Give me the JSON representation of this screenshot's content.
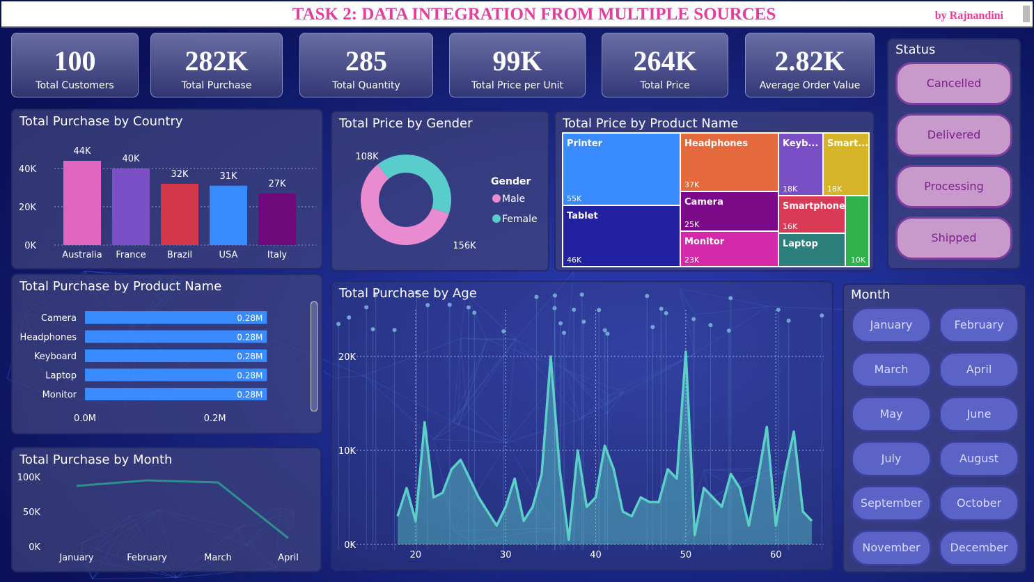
{
  "header": {
    "title": "TASK 2: DATA INTEGRATION FROM MULTIPLE SOURCES",
    "byline": "by Rajnandini"
  },
  "kpis": [
    {
      "value": "100",
      "label": "Total Customers"
    },
    {
      "value": "282K",
      "label": "Total Purchase"
    },
    {
      "value": "285",
      "label": "Total Quantity"
    },
    {
      "value": "99K",
      "label": "Total Price per Unit"
    },
    {
      "value": "264K",
      "label": "Total Price"
    },
    {
      "value": "2.82K",
      "label": "Average Order Value"
    }
  ],
  "status": {
    "title": "Status",
    "items": [
      "Cancelled",
      "Delivered",
      "Processing",
      "Shipped"
    ]
  },
  "month_slicer": {
    "title": "Month",
    "items": [
      "January",
      "February",
      "March",
      "April",
      "May",
      "June",
      "July",
      "August",
      "September",
      "October",
      "November",
      "December"
    ]
  },
  "colors": {
    "pink": "#e066c0",
    "purple": "#7b4fc6",
    "red": "#d13649",
    "blue": "#3a8bff",
    "darkpurple": "#6e0a7c",
    "teal": "#5ccfc8",
    "male": "#e98bd0",
    "female": "#59cccc"
  },
  "chart_data": [
    {
      "id": "country",
      "type": "bar",
      "title": "Total Purchase by Country",
      "categories": [
        "Australia",
        "France",
        "Brazil",
        "USA",
        "Italy"
      ],
      "values": [
        44,
        40,
        32,
        31,
        27
      ],
      "data_labels": [
        "44K",
        "40K",
        "32K",
        "31K",
        "27K"
      ],
      "yticks": [
        "0K",
        "20K",
        "40K"
      ],
      "ylim": [
        0,
        50
      ]
    },
    {
      "id": "gender",
      "type": "pie",
      "title": "Total Price by Gender",
      "legend_title": "Gender",
      "categories": [
        "Male",
        "Female"
      ],
      "values": [
        156,
        108
      ],
      "data_labels": [
        "156K",
        "108K"
      ]
    },
    {
      "id": "product_price",
      "type": "heatmap",
      "title": "Total Price by Product Name",
      "categories": [
        "Printer",
        "Tablet",
        "Headphones",
        "Camera",
        "Monitor",
        "Keyb...",
        "Smart...",
        "Smartphone",
        "Laptop",
        ""
      ],
      "values": [
        55,
        46,
        37,
        25,
        23,
        18,
        18,
        16,
        13,
        10
      ],
      "data_labels": [
        "55K",
        "46K",
        "37K",
        "25K",
        "23K",
        "18K",
        "18K",
        "16K",
        "",
        "10K"
      ]
    },
    {
      "id": "product_purchase",
      "type": "bar",
      "orientation": "horizontal",
      "title": "Total Purchase by Product Name",
      "categories": [
        "Camera",
        "Headphones",
        "Keyboard",
        "Laptop",
        "Monitor"
      ],
      "values": [
        0.28,
        0.28,
        0.28,
        0.28,
        0.28
      ],
      "data_labels": [
        "0.28M",
        "0.28M",
        "0.28M",
        "0.28M",
        "0.28M"
      ],
      "xticks": [
        "0.0M",
        "0.2M"
      ],
      "xlim": [
        0,
        0.3
      ]
    },
    {
      "id": "month_line",
      "type": "line",
      "title": "Total Purchase by Month",
      "categories": [
        "January",
        "February",
        "March",
        "April"
      ],
      "values": [
        87,
        95,
        92,
        12
      ],
      "yticks": [
        "0K",
        "50K",
        "100K"
      ],
      "ylim": [
        0,
        100
      ]
    },
    {
      "id": "age_area",
      "type": "area",
      "title": "Total Purchase by Age",
      "x": [
        18,
        19,
        20,
        21,
        22,
        23,
        24,
        25,
        26,
        27,
        28,
        29,
        30,
        31,
        32,
        33,
        34,
        35,
        36,
        37,
        38,
        39,
        40,
        41,
        42,
        43,
        44,
        45,
        46,
        47,
        48,
        49,
        50,
        51,
        52,
        53,
        54,
        55,
        56,
        57,
        58,
        59,
        60,
        61,
        62,
        63,
        64
      ],
      "values": [
        3,
        6,
        2.5,
        13,
        5,
        5.5,
        8,
        9,
        7,
        5,
        3.5,
        2,
        4,
        7,
        2.5,
        4,
        7.5,
        20,
        8,
        0.5,
        10,
        4,
        5,
        10.5,
        8,
        3.5,
        3,
        5,
        4.5,
        4.5,
        8,
        7,
        20.5,
        1,
        6,
        5,
        4,
        7.5,
        6,
        2,
        7,
        12.5,
        2,
        7.5,
        12,
        3.5,
        2.5
      ],
      "xticks": [
        "20",
        "30",
        "40",
        "50",
        "60"
      ],
      "yticks": [
        "0K",
        "10K",
        "20K"
      ],
      "xlim": [
        18,
        64
      ],
      "ylim": [
        0,
        20
      ]
    }
  ]
}
